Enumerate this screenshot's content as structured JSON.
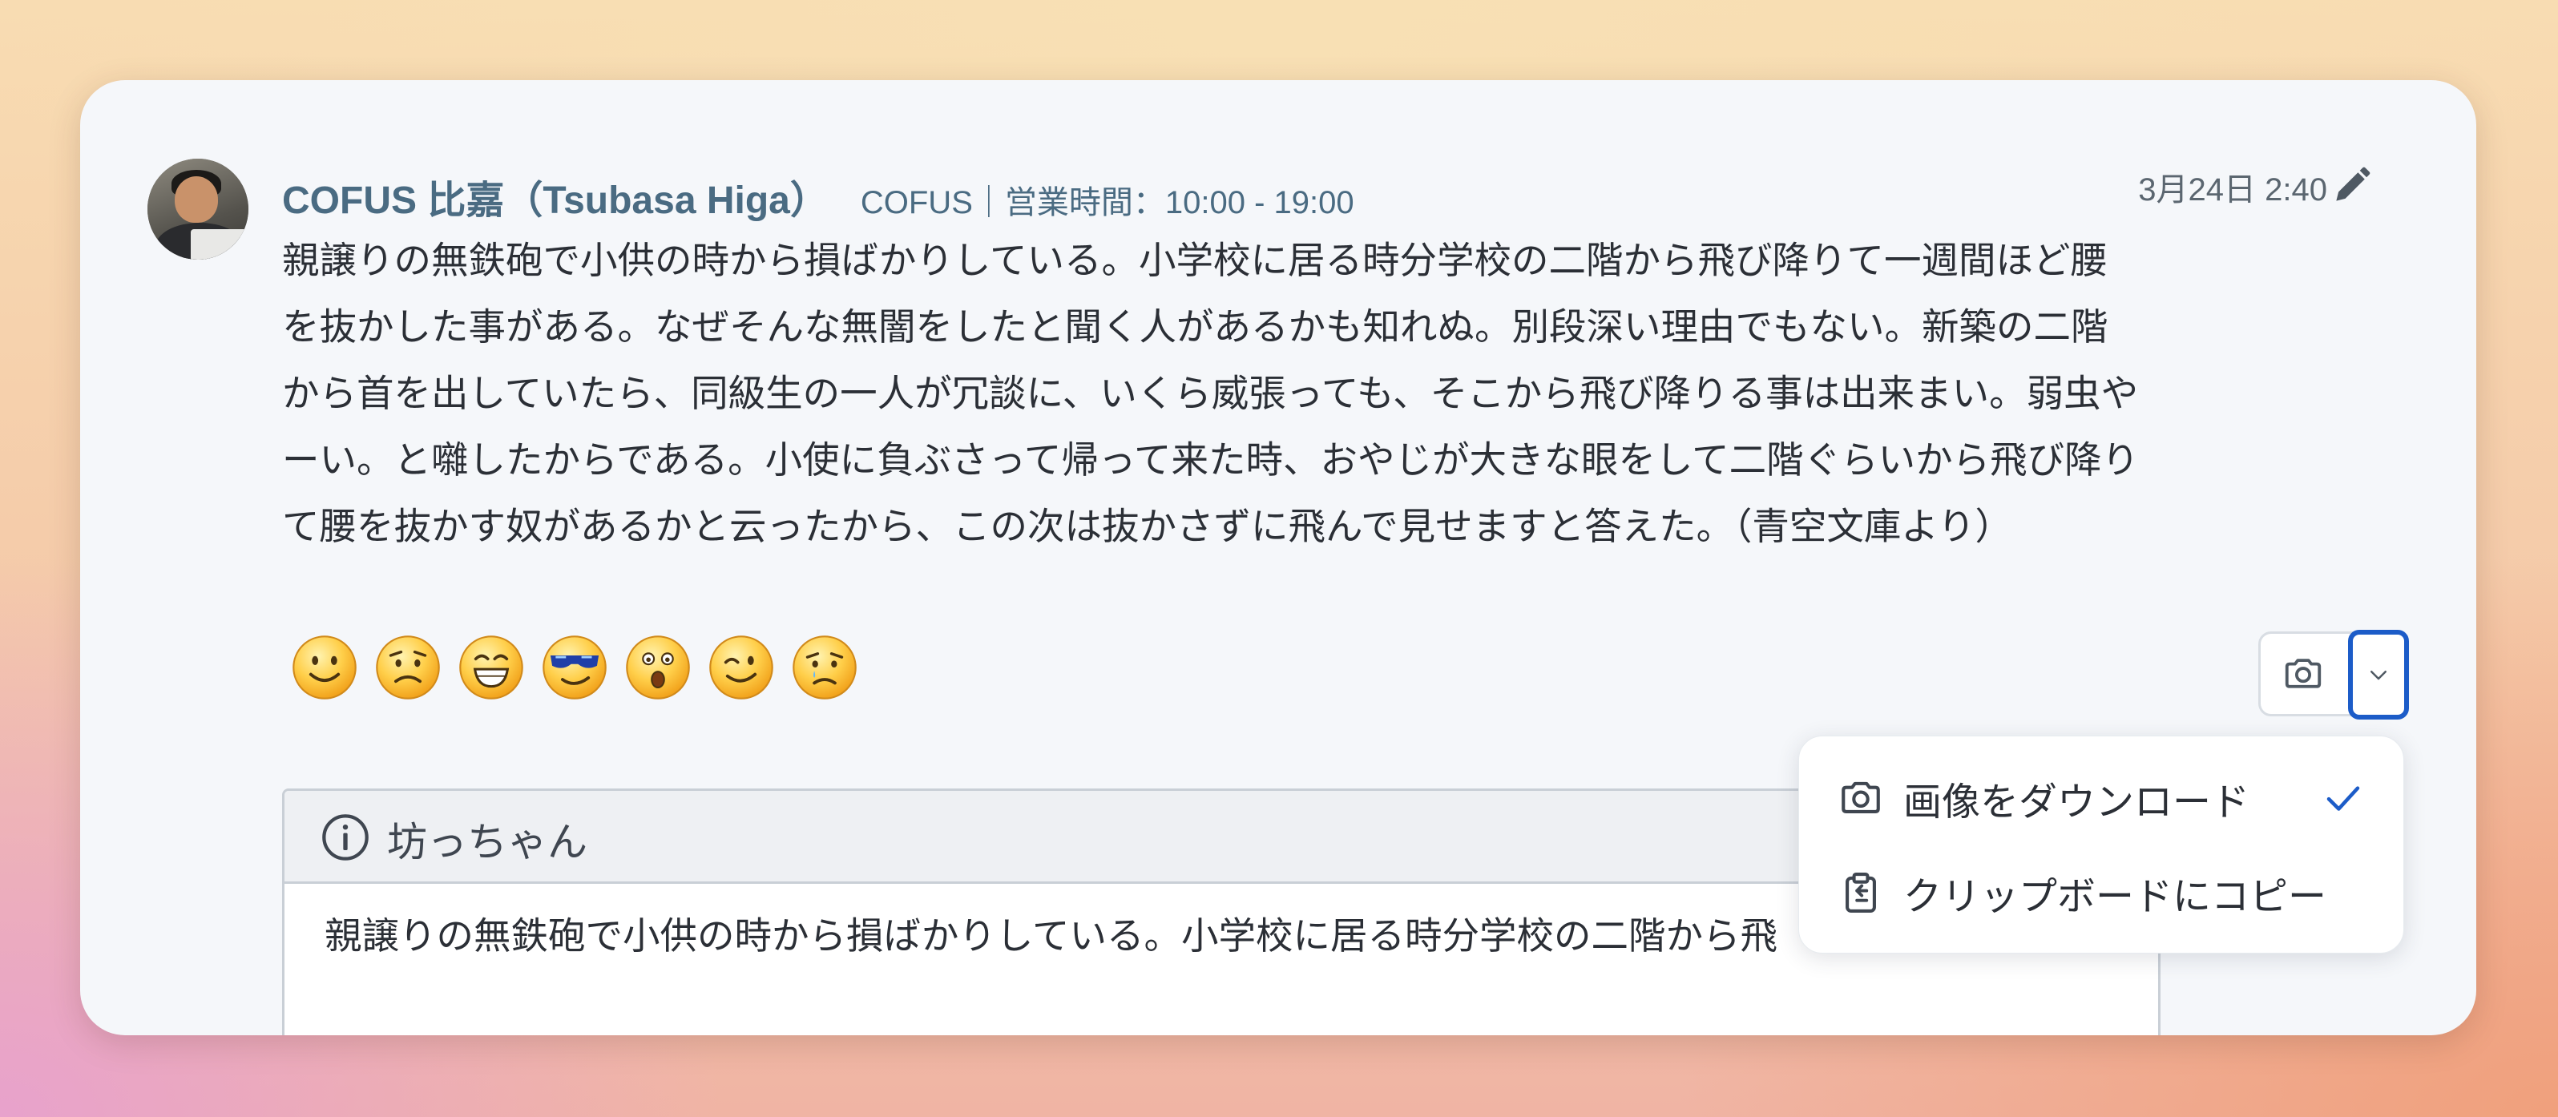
{
  "post": {
    "author_name": "COFUS 比嘉（Tsubasa Higa）",
    "author_sub": "COFUS｜営業時間：10:00 - 19:00",
    "timestamp": "3月24日 2:40",
    "message": "親譲りの無鉄砲で小供の時から損ばかりしている。小学校に居る時分学校の二階から飛び降りて一週間ほど腰を抜かした事がある。なぜそんな無闇をしたと聞く人があるかも知れぬ。別段深い理由でもない。新築の二階から首を出していたら、同級生の一人が冗談に、いくら威張っても、そこから飛び降りる事は出来まい。弱虫やーい。と囃したからである。小使に負ぶさって帰って来た時、おやじが大きな眼をして二階ぐらいから飛び降りて腰を抜かす奴があるかと云ったから、この次は抜かさずに飛んで見せますと答えた。（青空文庫より）",
    "emojis": [
      {
        "name": "smile-emoji"
      },
      {
        "name": "worried-emoji"
      },
      {
        "name": "grin-emoji"
      },
      {
        "name": "sunglasses-emoji"
      },
      {
        "name": "surprised-emoji"
      },
      {
        "name": "wink-emoji"
      },
      {
        "name": "crying-emoji"
      }
    ]
  },
  "menu": {
    "items": [
      {
        "label": "画像をダウンロード",
        "icon": "camera-icon",
        "checked": true
      },
      {
        "label": "クリップボードにコピー",
        "icon": "clipboard-icon",
        "checked": false
      }
    ]
  },
  "attachment": {
    "title": "坊っちゃん",
    "preview": "親譲りの無鉄砲で小供の時から損ばかりしている。小学校に居る時分学校の二階から飛"
  },
  "colors": {
    "accent": "#1c5cc8",
    "author": "#4a6b82",
    "card_bg": "#f5f7fa"
  }
}
